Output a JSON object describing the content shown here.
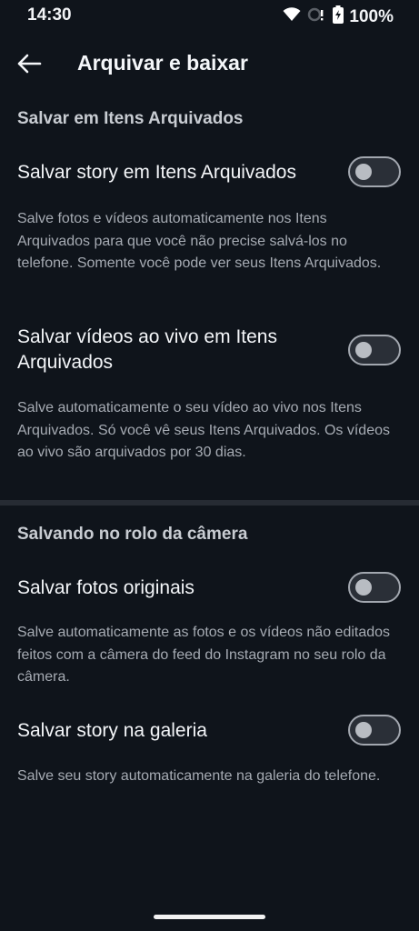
{
  "status": {
    "time": "14:30",
    "battery": "100%"
  },
  "header": {
    "title": "Arquivar e baixar"
  },
  "sections": [
    {
      "title": "Salvar em Itens Arquivados",
      "items": [
        {
          "label": "Salvar story em Itens Arquivados",
          "description": "Salve fotos e vídeos automaticamente nos Itens Arquivados para que você não precise salvá-los no telefone. Somente você pode ver seus Itens Arquivados.",
          "enabled": false
        },
        {
          "label": "Salvar vídeos ao vivo em Itens Arquivados",
          "description": "Salve automaticamente o seu vídeo ao vivo nos Itens Arquivados. Só você vê seus Itens Arquivados. Os vídeos ao vivo são arquivados por 30 dias.",
          "enabled": false
        }
      ]
    },
    {
      "title": "Salvando no rolo da câmera",
      "items": [
        {
          "label": "Salvar fotos originais",
          "description": "Salve automaticamente as fotos e os vídeos não editados feitos com a câmera do feed do Instagram no seu rolo da câmera.",
          "enabled": false
        },
        {
          "label": "Salvar story na galeria",
          "description": "Salve seu story automaticamente na galeria do telefone.",
          "enabled": false
        }
      ]
    }
  ]
}
